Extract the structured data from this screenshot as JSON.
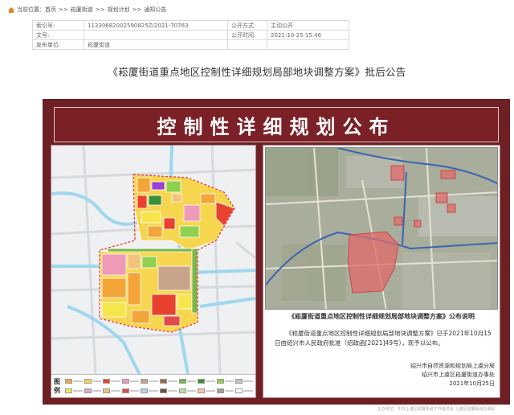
{
  "breadcrumb": {
    "items": [
      "当前位置：首页",
      "崧厦街道",
      "规划计划",
      "通知公告"
    ],
    "separator": ">>"
  },
  "meta": {
    "index_label": "索引号:",
    "index_value": "11330682002590825Z/2021-70763",
    "open_mode_label": "公开方式:",
    "open_mode_value": "主动公开",
    "doc_no_label": "文号:",
    "doc_no_value": "",
    "open_date_label": "公开时间:",
    "open_date_value": "2021-10-25 15:46",
    "publisher_label": "发布单位:",
    "publisher_value": "崧厦街道"
  },
  "article": {
    "title": "《崧厦街道重点地区控制性详细规划局部地块调整方案》批后公告"
  },
  "board": {
    "banner_text": "控制性详细规划公布",
    "legend_label": "图例",
    "caption_title": "《崧厦街道重点地区控制性详细规划局部地块调整方案》公布说明",
    "caption_body": "《崧厦街道重点地区控制性详细规划局部地块调整方案》已于2021年10月15日由绍兴市人民政府批准（绍政函[2021]49号），现予以公布。",
    "sign_line1": "绍兴市自然资源和规划局上虞分局",
    "sign_line2": "绍兴市上虞区崧厦街道办事处",
    "sign_date": "2021年10月25日"
  },
  "legend_colors": [
    "#f4a53a",
    "#f6d64e",
    "#e8412f",
    "#ef9ab6",
    "#c8a58a",
    "#9c6b3d",
    "#7ab648",
    "#3a8f3a",
    "#8fd14f",
    "#c4c4c4",
    "#f6e64e",
    "#d9a8d6",
    "#f0c27a",
    "#e24a4a",
    "#a8d8f0",
    "#6f4e37",
    "#b5e3a0",
    "#f7c59f",
    "#9e9e9e",
    "#ffffff"
  ],
  "footer": {
    "note": "主办单位：中共上虞区崧厦街道工作委员会 上虞区崧厦街道办事处"
  },
  "colors": {
    "board_bg": "#6d1f24",
    "banner_bg": "#7b2027",
    "water": "#9fd6f0",
    "red_zone": "#e06a6a"
  }
}
